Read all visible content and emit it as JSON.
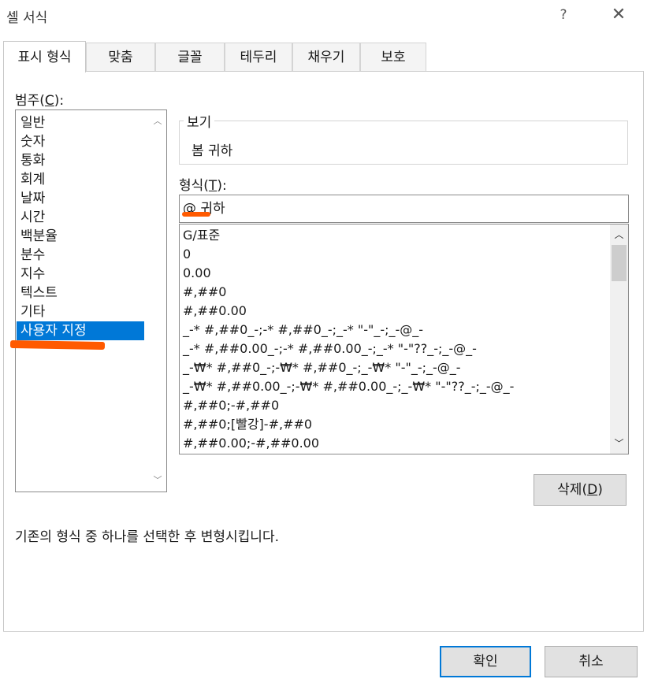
{
  "window": {
    "title": "셀 서식",
    "help_glyph": "?",
    "close_glyph": "✕"
  },
  "tabs": [
    {
      "label": "표시 형식",
      "active": true
    },
    {
      "label": "맞춤"
    },
    {
      "label": "글꼴"
    },
    {
      "label": "테두리"
    },
    {
      "label": "채우기"
    },
    {
      "label": "보호"
    }
  ],
  "category": {
    "label_prefix": "범주(",
    "label_key": "C",
    "label_suffix": "):",
    "items": [
      "일반",
      "숫자",
      "통화",
      "회계",
      "날짜",
      "시간",
      "백분율",
      "분수",
      "지수",
      "텍스트",
      "기타",
      "사용자 지정"
    ],
    "selected": "사용자 지정"
  },
  "preview": {
    "legend": "보기",
    "value": "봄 귀하"
  },
  "format": {
    "label_prefix": "형식(",
    "label_key": "T",
    "label_suffix": "):",
    "input_value": "@ 귀하",
    "list": [
      "G/표준",
      "0",
      "0.00",
      "#,##0",
      "#,##0.00",
      "_-* #,##0_-;-* #,##0_-;_-* \"-\"_-;_-@_-",
      "_-* #,##0.00_-;-* #,##0.00_-;_-* \"-\"??_-;_-@_-",
      "_-₩* #,##0_-;-₩* #,##0_-;_-₩* \"-\"_-;_-@_-",
      "_-₩* #,##0.00_-;-₩* #,##0.00_-;_-₩* \"-\"??_-;_-@_-",
      "#,##0;-#,##0",
      "#,##0;[빨강]-#,##0",
      "#,##0.00;-#,##0.00"
    ]
  },
  "buttons": {
    "delete_prefix": "삭제(",
    "delete_key": "D",
    "delete_suffix": ")",
    "ok": "확인",
    "cancel": "취소"
  },
  "hint": "기존의 형식 중 하나를 선택한 후 변형시킵니다.",
  "scroll": {
    "up_glyph": "︿",
    "down_glyph": "﹀"
  },
  "annotation_color": "#ff5a00",
  "accent_color": "#0078d7"
}
